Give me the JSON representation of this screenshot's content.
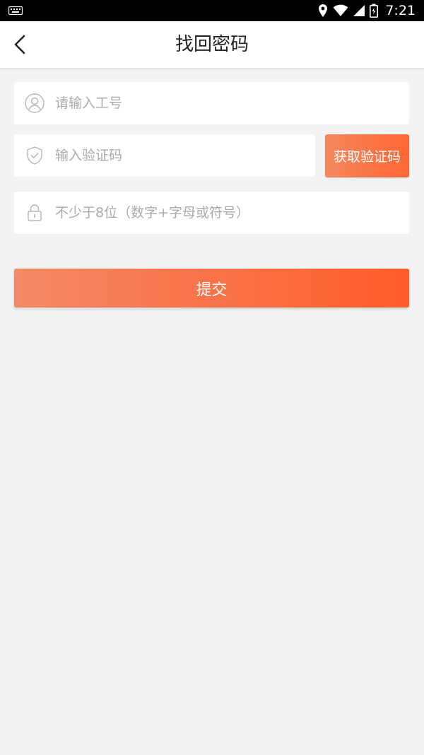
{
  "status_bar": {
    "time": "7:21",
    "icons": [
      "keyboard-icon",
      "location-icon",
      "wifi-icon",
      "signal-icon",
      "battery-icon"
    ]
  },
  "header": {
    "title": "找回密码",
    "back_icon": "chevron-left-icon"
  },
  "form": {
    "account": {
      "placeholder": "请输入工号",
      "value": "",
      "icon": "user-icon"
    },
    "code": {
      "placeholder": "输入验证码",
      "value": "",
      "icon": "shield-check-icon"
    },
    "get_code_label": "获取验证码",
    "password": {
      "placeholder": "不少于8位（数字+字母或符号）",
      "value": "",
      "icon": "lock-icon"
    },
    "submit_label": "提交"
  },
  "colors": {
    "accent_start": "#f48a67",
    "accent_end": "#ff5c2a",
    "background": "#f3f3f3",
    "placeholder": "#aaaaaa"
  }
}
